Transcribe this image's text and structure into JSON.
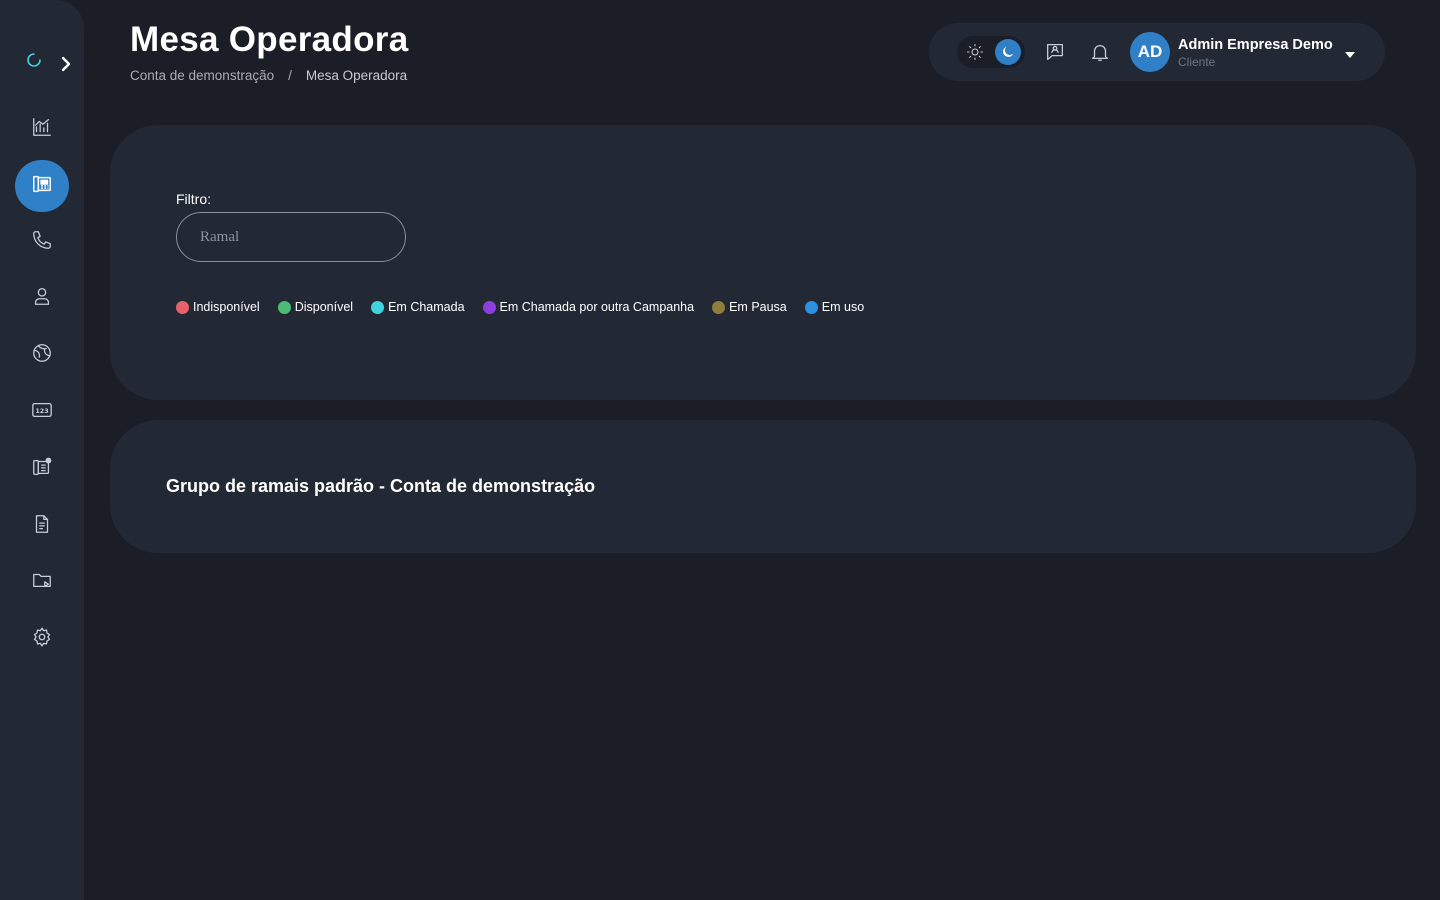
{
  "header": {
    "title": "Mesa Operadora",
    "breadcrumb": {
      "parent": "Conta de demonstração",
      "separator": "/",
      "current": "Mesa Operadora"
    }
  },
  "sidebar": {
    "brand_icon": "loading-logo-icon",
    "expand_icon": "chevron-right-icon",
    "items": [
      {
        "name": "dashboard",
        "icon": "chart-icon",
        "active": false
      },
      {
        "name": "mesa-operadora",
        "icon": "operator-desk-icon",
        "active": true
      },
      {
        "name": "calls",
        "icon": "phone-icon",
        "active": false
      },
      {
        "name": "users",
        "icon": "user-icon",
        "active": false
      },
      {
        "name": "routes",
        "icon": "globe-icon",
        "active": false
      },
      {
        "name": "numbers",
        "icon": "numbers-icon",
        "active": false
      },
      {
        "name": "extensions",
        "icon": "extension-panel-icon",
        "active": false
      },
      {
        "name": "reports",
        "icon": "document-icon",
        "active": false
      },
      {
        "name": "recordings",
        "icon": "folder-play-icon",
        "active": false
      },
      {
        "name": "settings",
        "icon": "gear-icon",
        "active": false
      }
    ]
  },
  "topbar": {
    "theme": {
      "light_icon": "sun-icon",
      "dark_icon": "moon-icon",
      "selected": "dark"
    },
    "chat_icon": "chat-agent-icon",
    "notification_icon": "bell-icon",
    "user": {
      "initials": "AD",
      "name": "Admin Empresa Demo",
      "role": "Cliente"
    }
  },
  "filter": {
    "label": "Filtro:",
    "input": {
      "placeholder": "Ramal",
      "value": ""
    }
  },
  "legend": [
    {
      "label": "Indisponível",
      "color": "#e8606a"
    },
    {
      "label": "Disponível",
      "color": "#4cbc74"
    },
    {
      "label": "Em Chamada",
      "color": "#3fd3e0"
    },
    {
      "label": "Em Chamada por outra Campanha",
      "color": "#8b3fe0"
    },
    {
      "label": "Em Pausa",
      "color": "#8e7e3a"
    },
    {
      "label": "Em uso",
      "color": "#2f8fe0"
    }
  ],
  "group": {
    "title": "Grupo de ramais padrão - Conta de demonstração"
  },
  "colors": {
    "accent": "#2f80c7",
    "background": "#1b1e26",
    "panel": "#222834"
  }
}
